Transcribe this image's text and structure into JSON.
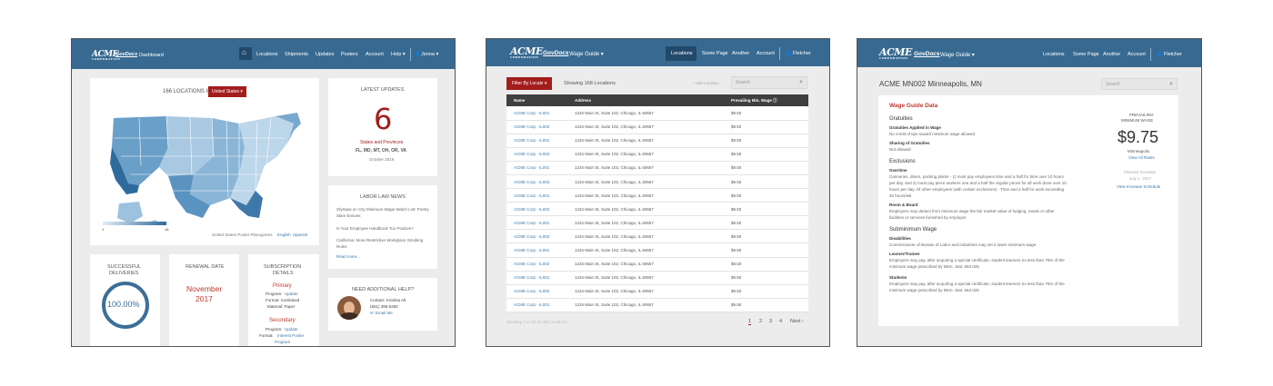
{
  "dashboard": {
    "nav": {
      "logo": "ACME",
      "logo_sub": "CORPORATION",
      "govdocs": "GovDocs",
      "section": "Dashboard",
      "home_icon": "home-icon",
      "links": [
        "Locations",
        "Shipments",
        "Updates",
        "Posters",
        "Account",
        "Help ▾"
      ],
      "user": "Jenna ▾"
    },
    "map_card": {
      "locations_text": "166 LOCATIONS IN",
      "country_button": "United States ▾",
      "legend_min": "1",
      "legend_max": "18",
      "footer_text": "United States Poster Planograms",
      "link_english": "English",
      "link_spanish": "Spanish"
    },
    "latest_updates": {
      "title": "LATEST UPDATES",
      "count": "6",
      "label": "States and Provinces",
      "states": "FL, MD, MT, OH, OR, VA",
      "date": "October 2016"
    },
    "labor_news": {
      "title": "LABOR LAW NEWS",
      "items": [
        "Olympia on City Minimum Wage Watch List: Poetry Slam Ensues",
        "Is Your Employee Handbook Too Positive?",
        "California: More Restrictive Workplace Smoking Rules"
      ],
      "read_more": "Read more..."
    },
    "deliveries": {
      "title_line1": "SUCCESSFUL",
      "title_line2": "DELIVERIES",
      "value": "100.00%",
      "fraction": 1.0
    },
    "renewal": {
      "title": "RENEWAL DATE",
      "month": "November",
      "year": "2017"
    },
    "subscription": {
      "title_line1": "SUBSCRIPTION",
      "title_line2": "DETAILS",
      "primary": "Primary",
      "primary_program_label": "Program:",
      "primary_program": "Update",
      "primary_format": "Format: Combined",
      "primary_material": "Material: Paper",
      "secondary": "Secondary",
      "secondary_program_label": "Program:",
      "secondary_program": "Update",
      "secondary_format_label": "Format:",
      "secondary_format": "Interest Poster",
      "secondary_format2": "Program"
    },
    "help": {
      "title": "NEED ADDITIONAL HELP?",
      "contact": "Contact: Kristina Alt",
      "phone": "(651) 395-5250",
      "email": "Email Me"
    }
  },
  "locations": {
    "nav": {
      "logo": "ACME",
      "logo_sub": "CORPORATION",
      "govdocs": "GovDocs",
      "section": "Wage Guide ▾",
      "links": [
        "Locations",
        "Some Page",
        "Another",
        "Account"
      ],
      "user": "Fletcher"
    },
    "filter_button": "Filter By Locale ▾",
    "showing": "Showing 168 Locations",
    "add_location": "+ Add Location",
    "search_placeholder": "Search",
    "table": {
      "headers": [
        "Name",
        "Address",
        "Prevailing Min. Wage"
      ],
      "rows": [
        [
          "ACME Corp - IL001",
          "1234 Main St, Suite 102, Chicago, IL 60657",
          "$9.50"
        ],
        [
          "ACME Corp - IL002",
          "1234 Main St, Suite 102, Chicago, IL 60657",
          "$9.50"
        ],
        [
          "ACME Corp - IL001",
          "1234 Main St, Suite 102, Chicago, IL 60657",
          "$9.50"
        ],
        [
          "ACME Corp - IL002",
          "1234 Main St, Suite 102, Chicago, IL 60657",
          "$9.50"
        ],
        [
          "ACME Corp - IL001",
          "1234 Main St, Suite 102, Chicago, IL 60657",
          "$9.50"
        ],
        [
          "ACME Corp - IL002",
          "1234 Main St, Suite 102, Chicago, IL 60657",
          "$9.50"
        ],
        [
          "ACME Corp - IL001",
          "1234 Main St, Suite 102, Chicago, IL 60657",
          "$9.50"
        ],
        [
          "ACME Corp - IL002",
          "1234 Main St, Suite 102, Chicago, IL 60657",
          "$9.50"
        ],
        [
          "ACME Corp - IL001",
          "1234 Main St, Suite 102, Chicago, IL 60657",
          "$9.50"
        ],
        [
          "ACME Corp - IL002",
          "1234 Main St, Suite 102, Chicago, IL 60657",
          "$9.50"
        ],
        [
          "ACME Corp - IL001",
          "1234 Main St, Suite 102, Chicago, IL 60657",
          "$9.50"
        ],
        [
          "ACME Corp - IL002",
          "1234 Main St, Suite 102, Chicago, IL 60657",
          "$9.50"
        ],
        [
          "ACME Corp - IL001",
          "1234 Main St, Suite 102, Chicago, IL 60657",
          "$9.50"
        ],
        [
          "ACME Corp - IL002",
          "1234 Main St, Suite 102, Chicago, IL 60657",
          "$9.50"
        ],
        [
          "ACME Corp - IL001",
          "1234 Main St, Suite 102, Chicago, IL 60657",
          "$9.50"
        ]
      ]
    },
    "footer_showing": "Showing 1 to 20 of 168 Locations",
    "pagination": [
      "1",
      "2",
      "3",
      "4",
      "Next ›"
    ]
  },
  "wage_detail": {
    "nav": {
      "logo": "ACME",
      "logo_sub": "CORPORATION",
      "govdocs": "GovDocs",
      "section": "Wage Guide ▾",
      "links": [
        "Locations",
        "Some Page",
        "Another",
        "Account"
      ],
      "user": "Fletcher"
    },
    "page_title": "ACME MN002 Minneapolis, MN",
    "search_placeholder": "Search",
    "section_title": "Wage Guide Data",
    "gratuities": {
      "heading": "Gratuities",
      "applied_label": "Gratuities Applied in Wage",
      "applied_text": "No credit of tips toward minimum wage allowed",
      "sharing_label": "Sharing of Gratuities",
      "sharing_text": "Not allowed"
    },
    "exclusions": {
      "heading": "Exclusions",
      "overtime_label": "Overtime",
      "overtime_lines": [
        "Canneries, driers, packing plants - 1) must pay employees time and a half for time over 10 hours",
        "per day, and 2) must pay piece workers one and a half the regular prices for all work done over 10",
        "hours per day. All other employees (with certain exclusions) - Time and a half for work exceeding",
        "40 hours/wk"
      ],
      "room_label": "Room & Board",
      "room_lines": [
        "Employers may deduct from minimum wage the fair market value of lodging, meals or other",
        "facilities or services furnished by employer"
      ]
    },
    "subminimum": {
      "heading": "Subminimum Wage",
      "disabilities_label": "Disabilities",
      "disabilities_text": "Commissioner of Bureau of Labor and Industries may set a lower minimum wage.",
      "learner_label": "Learner/Trainee",
      "learner_lines": [
        "Employers may pay, after acquiring a special certificate, student learners no less than 75% of the",
        "minimum wage prescribed by Minn. Stat. 653.025"
      ],
      "students_label": "Students",
      "students_lines": [
        "Employers may pay, after acquiring a special certificate, student learners no less than 75% of the",
        "minimum wage prescribed by Minn. Stat. 653.025"
      ]
    },
    "prevailing": {
      "label_line1": "PREVAILING",
      "label_line2": "MINIMUM WAGE",
      "value": "$9.75",
      "city": "Minneapolis",
      "view_rates": "View All Rates",
      "planned_label": "Planned Increase",
      "planned_date": "July 1, 2017",
      "schedule_link": "View Increase Schedule"
    }
  }
}
